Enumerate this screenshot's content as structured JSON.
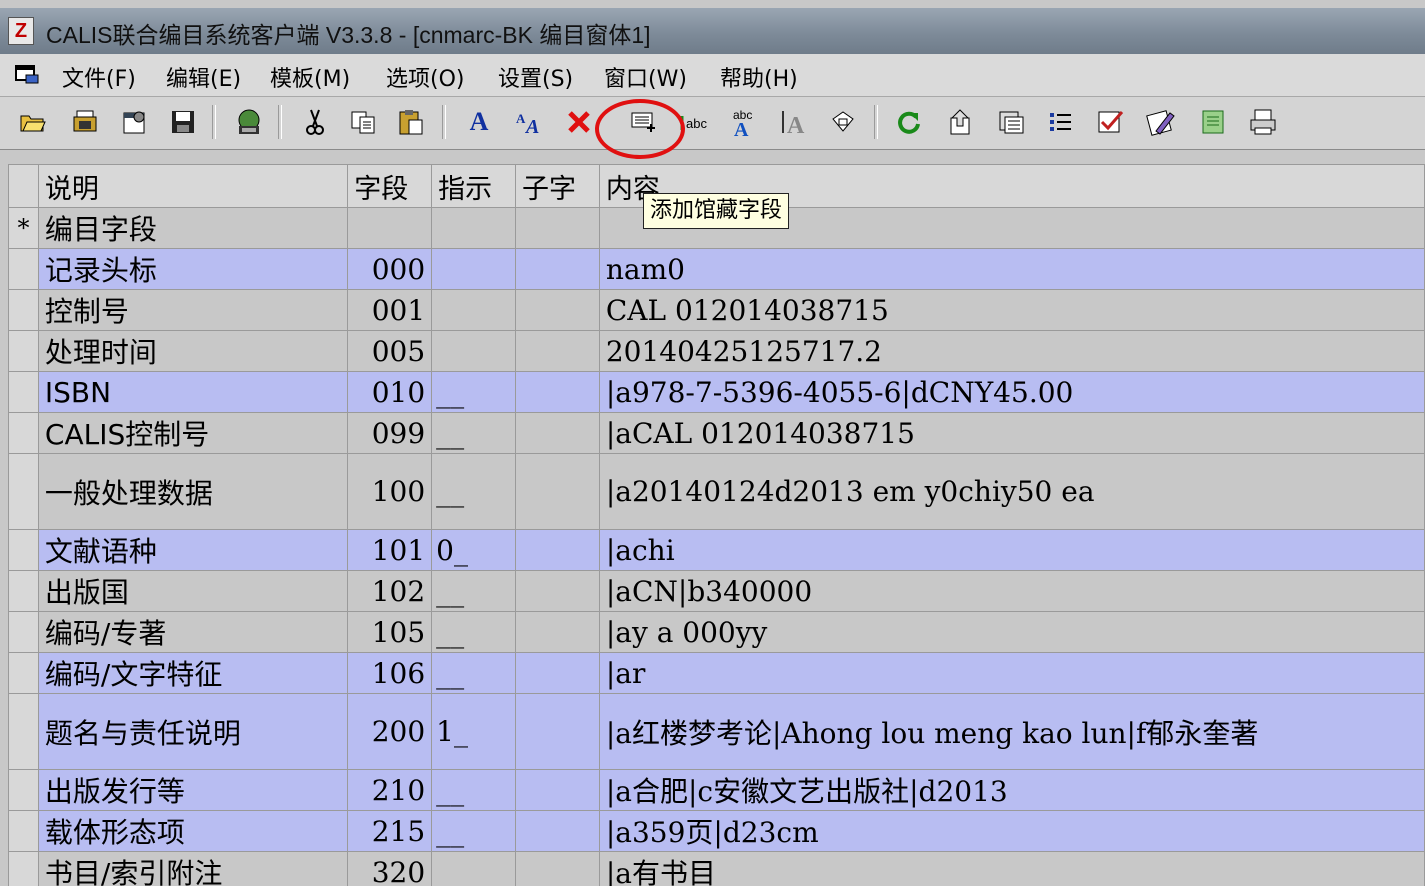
{
  "window": {
    "title_app": "CALIS联合编目系统客户端 V3.3.8 - ",
    "title_doc": "[cnmarc-BK 编目窗体1]",
    "app_icon": "Z"
  },
  "menu": [
    "文件(F)",
    "编辑(E)",
    "模板(M)",
    "选项(O)",
    "设置(S)",
    "窗口(W)",
    "帮助(H)"
  ],
  "toolbar": {
    "buttons": [
      "open-folder-icon",
      "copy-record-icon",
      "properties-icon",
      "save-icon",
      "globe-save-icon",
      "cut-icon",
      "copy-icon",
      "paste-icon",
      "font-a-icon",
      "font-size-icon",
      "delete-icon",
      "add-holding-field-icon",
      "abc-icon",
      "spellcheck-icon",
      "align-icon",
      "select-icon",
      "refresh-icon",
      "upload-icon",
      "clipboard-icon",
      "list-icon",
      "check-icon",
      "edit-icon",
      "note-icon",
      "print-icon"
    ]
  },
  "tooltip": "添加馆藏字段",
  "table": {
    "headers": [
      "说明",
      "字段",
      "指示",
      "子字",
      "内容"
    ],
    "rows": [
      {
        "mark": "*",
        "desc": "编目字段",
        "field": "",
        "ind": "",
        "sub": "",
        "content": "",
        "style": "head"
      },
      {
        "mark": "",
        "desc": "记录头标",
        "field": "000",
        "ind": "",
        "sub": "",
        "content": "nam0",
        "style": "blue"
      },
      {
        "mark": "",
        "desc": "控制号",
        "field": "001",
        "ind": "",
        "sub": "",
        "content": "CAL  012014038715",
        "style": "gray"
      },
      {
        "mark": "",
        "desc": "处理时间",
        "field": "005",
        "ind": "",
        "sub": "",
        "content": "20140425125717.2",
        "style": "gray"
      },
      {
        "mark": "",
        "desc": "ISBN",
        "field": "010",
        "ind": "__",
        "sub": "",
        "content": "|a978-7-5396-4055-6|dCNY45.00",
        "style": "blue"
      },
      {
        "mark": "",
        "desc": "CALIS控制号",
        "field": "099",
        "ind": "__",
        "sub": "",
        "content": "|aCAL  012014038715",
        "style": "gray"
      },
      {
        "mark": "",
        "desc": "一般处理数据",
        "field": "100",
        "ind": "__",
        "sub": "",
        "content": "|a20140124d2013    em y0chiy50      ea",
        "style": "gray",
        "tall": true
      },
      {
        "mark": "",
        "desc": "文献语种",
        "field": "101",
        "ind": "0_",
        "sub": "",
        "content": "|achi",
        "style": "blue"
      },
      {
        "mark": "",
        "desc": "出版国",
        "field": "102",
        "ind": "__",
        "sub": "",
        "content": "|aCN|b340000",
        "style": "gray"
      },
      {
        "mark": "",
        "desc": "编码/专著",
        "field": "105",
        "ind": "__",
        "sub": "",
        "content": "|ay   a    000yy",
        "style": "gray"
      },
      {
        "mark": "",
        "desc": "编码/文字特征",
        "field": "106",
        "ind": "__",
        "sub": "",
        "content": "|ar",
        "style": "blue"
      },
      {
        "mark": "",
        "desc": "题名与责任说明",
        "field": "200",
        "ind": "1_",
        "sub": "",
        "content": "|a红楼梦考论|Ahong lou meng kao lun|f郁永奎著",
        "style": "blue",
        "tall": true
      },
      {
        "mark": "",
        "desc": "出版发行等",
        "field": "210",
        "ind": "__",
        "sub": "",
        "content": "|a合肥|c安徽文艺出版社|d2013",
        "style": "blue"
      },
      {
        "mark": "",
        "desc": "载体形态项",
        "field": "215",
        "ind": "__",
        "sub": "",
        "content": "|a359页|d23cm",
        "style": "blue"
      },
      {
        "mark": "",
        "desc": "书目/索引附注",
        "field": "320",
        "ind": "",
        "sub": "",
        "content": "|a有书目",
        "style": "gray"
      }
    ]
  }
}
